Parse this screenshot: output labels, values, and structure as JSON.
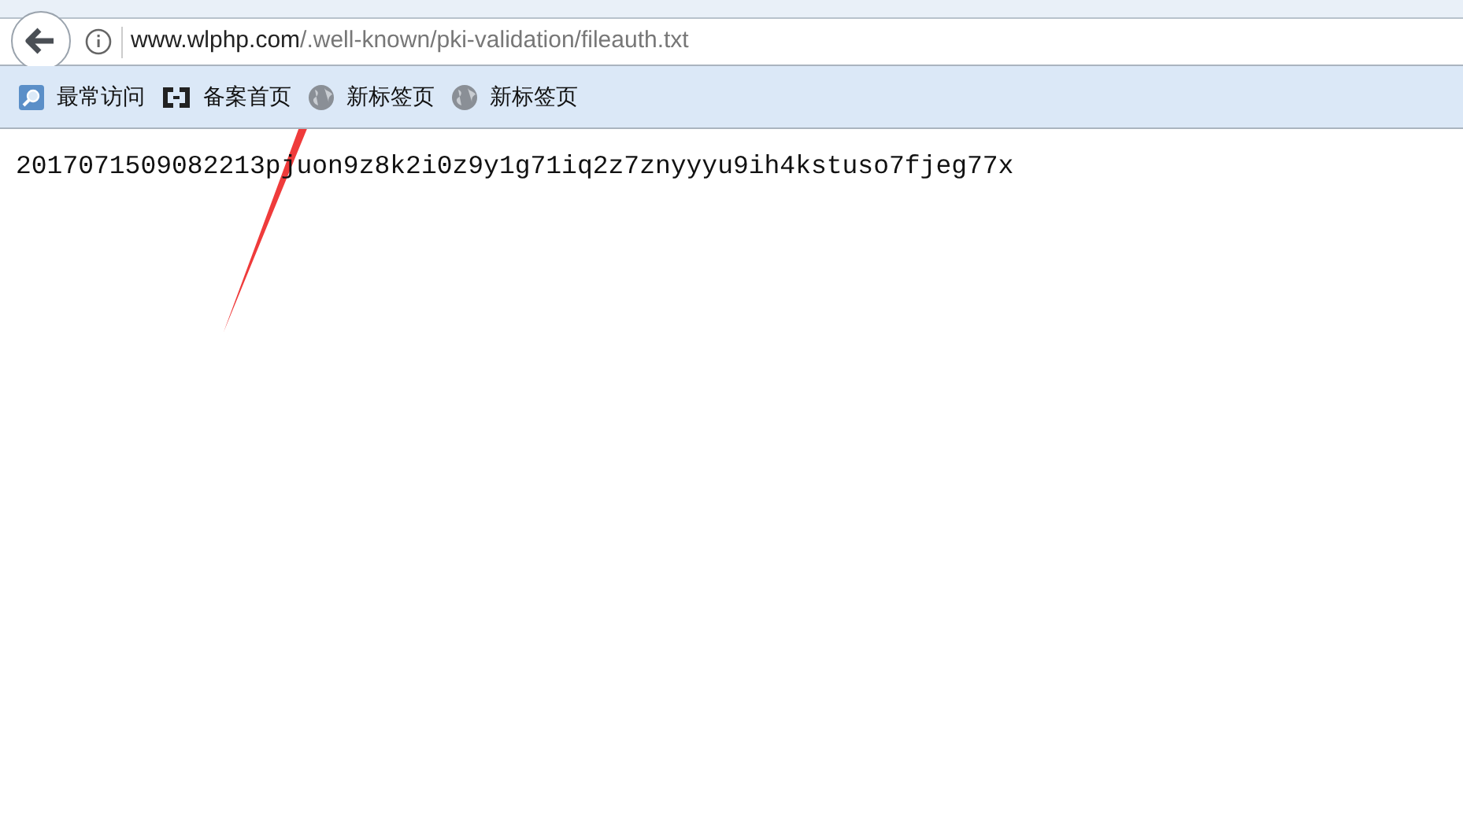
{
  "address_bar": {
    "host": "www.wlphp.com",
    "path": "/.well-known/pki-validation/fileauth.txt"
  },
  "bookmarks": [
    {
      "kind": "search",
      "label": "最常访问"
    },
    {
      "kind": "bracket",
      "label": "备案首页"
    },
    {
      "kind": "globe",
      "label": "新标签页"
    },
    {
      "kind": "globe",
      "label": "新标签页"
    }
  ],
  "page_text": "2017071509082213pjuon9z8k2i0z9y1g71iq2z7znyyyu9ih4kstuso7fjeg77x"
}
